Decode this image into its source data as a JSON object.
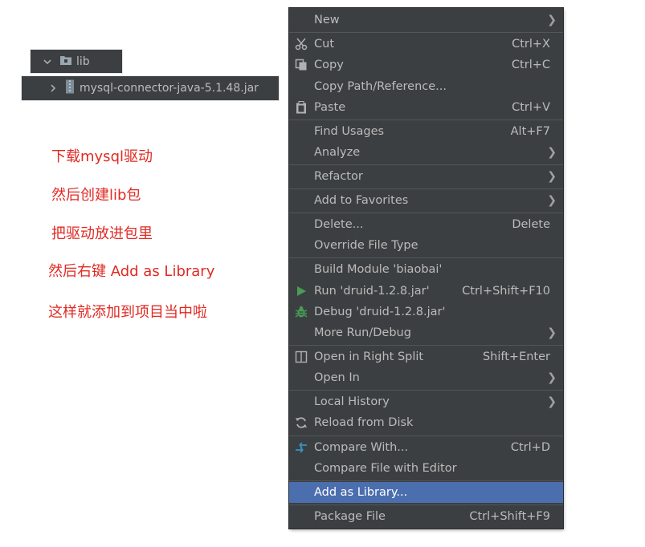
{
  "tree": {
    "folder_label": "lib",
    "jar_label": "mysql-connector-java-5.1.48.jar"
  },
  "notes": [
    "下载mysql驱动",
    "然后创建lib包",
    "把驱动放进包里",
    "然后右键 Add as Library",
    "这样就添加到项目当中啦"
  ],
  "menu": {
    "items": [
      {
        "label": "New",
        "submenu": true
      },
      {
        "label": "Cut",
        "shortcut": "Ctrl+X",
        "icon": "scissors-icon"
      },
      {
        "label": "Copy",
        "shortcut": "Ctrl+C",
        "icon": "copy-icon"
      },
      {
        "label": "Copy Path/Reference..."
      },
      {
        "label": "Paste",
        "shortcut": "Ctrl+V",
        "icon": "clipboard-icon"
      },
      {
        "label": "Find Usages",
        "shortcut": "Alt+F7"
      },
      {
        "label": "Analyze",
        "submenu": true
      },
      {
        "label": "Refactor",
        "submenu": true
      },
      {
        "label": "Add to Favorites",
        "submenu": true
      },
      {
        "label": "Delete...",
        "shortcut": "Delete"
      },
      {
        "label": "Override File Type"
      },
      {
        "label": "Build Module 'biaobai'"
      },
      {
        "label": "Run 'druid-1.2.8.jar'",
        "shortcut": "Ctrl+Shift+F10",
        "icon": "run-icon"
      },
      {
        "label": "Debug 'druid-1.2.8.jar'",
        "icon": "debug-icon"
      },
      {
        "label": "More Run/Debug",
        "submenu": true
      },
      {
        "label": "Open in Right Split",
        "shortcut": "Shift+Enter",
        "icon": "split-icon"
      },
      {
        "label": "Open In",
        "submenu": true
      },
      {
        "label": "Local History",
        "submenu": true
      },
      {
        "label": "Reload from Disk",
        "icon": "reload-icon"
      },
      {
        "label": "Compare With...",
        "shortcut": "Ctrl+D",
        "icon": "compare-icon"
      },
      {
        "label": "Compare File with Editor"
      },
      {
        "label": "Add as Library...",
        "selected": true
      },
      {
        "label": "Package File",
        "shortcut": "Ctrl+Shift+F9"
      }
    ]
  },
  "colors": {
    "menu_bg": "#3c3f41",
    "menu_text": "#bbbbbb",
    "selection": "#4b6eaf",
    "annotation": "#e02a23",
    "run_green": "#499c54"
  }
}
